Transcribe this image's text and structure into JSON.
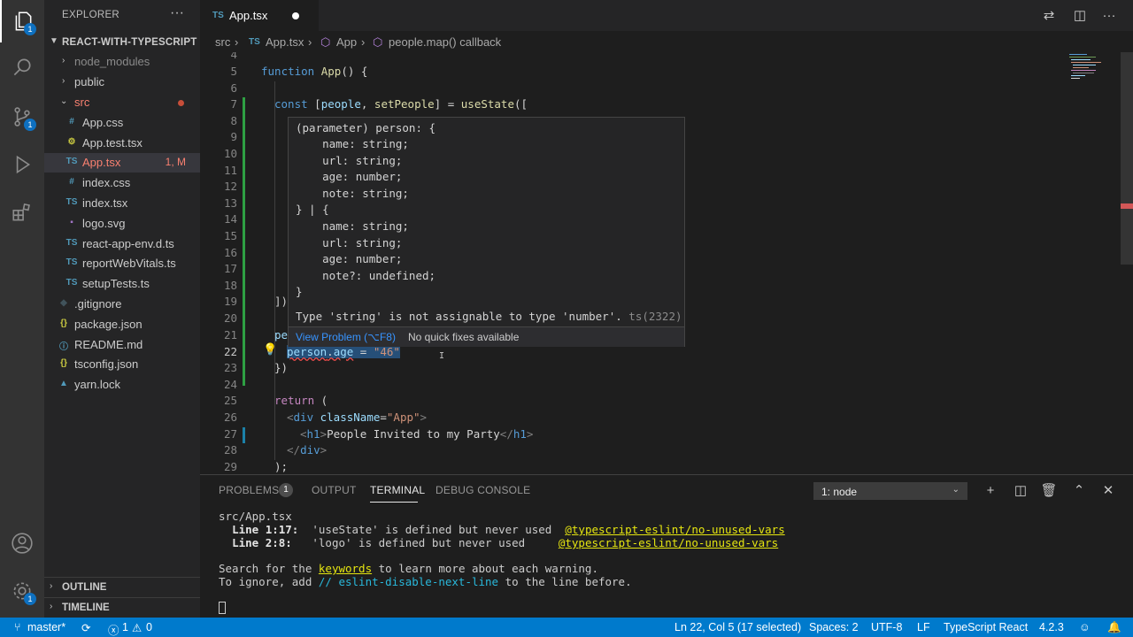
{
  "activity_bar": {
    "explorer_badge": "1",
    "scm_badge": "1",
    "manage_badge": "1"
  },
  "sidebar": {
    "title": "EXPLORER",
    "more": "···",
    "root_folder": "REACT-WITH-TYPESCRIPT",
    "items": [
      {
        "label": "node_modules",
        "kind": "folder"
      },
      {
        "label": "public",
        "kind": "folder"
      },
      {
        "label": "src",
        "kind": "folder-open"
      },
      {
        "label": "App.css",
        "icon": "#"
      },
      {
        "label": "App.test.tsx",
        "icon": "⚙"
      },
      {
        "label": "App.tsx",
        "icon": "TS",
        "status": "1, M"
      },
      {
        "label": "index.css",
        "icon": "#"
      },
      {
        "label": "index.tsx",
        "icon": "TS"
      },
      {
        "label": "logo.svg",
        "icon": "▪"
      },
      {
        "label": "react-app-env.d.ts",
        "icon": "TS"
      },
      {
        "label": "reportWebVitals.ts",
        "icon": "TS"
      },
      {
        "label": "setupTests.ts",
        "icon": "TS"
      },
      {
        "label": ".gitignore",
        "icon": "◆"
      },
      {
        "label": "package.json",
        "icon": "{}"
      },
      {
        "label": "README.md",
        "icon": "ⓘ"
      },
      {
        "label": "tsconfig.json",
        "icon": "{}"
      },
      {
        "label": "yarn.lock",
        "icon": "▲"
      }
    ],
    "outline": "OUTLINE",
    "timeline": "TIMELINE"
  },
  "tab": {
    "lang": "TS",
    "name": "App.tsx"
  },
  "breadcrumb": {
    "folder": "src",
    "file_lang": "TS",
    "file": "App.tsx",
    "symbol": "App",
    "callback": "people.map() callback"
  },
  "editor": {
    "line_numbers": [
      "4",
      "5",
      "6",
      "7",
      "8",
      "9",
      "10",
      "11",
      "12",
      "13",
      "14",
      "15",
      "16",
      "17",
      "18",
      "19",
      "20",
      "21",
      "22",
      "23",
      "24",
      "25",
      "26",
      "27",
      "28",
      "29"
    ],
    "lines": {
      "l5": {
        "kw": "function",
        "fn": "App",
        "rest": "() {"
      },
      "l7": {
        "kw": "const",
        "open": "[",
        "a": "people",
        "comma": ", ",
        "b": "setPeople",
        "close": "] = ",
        "fn": "useState",
        "tail": "(["
      },
      "l19": "])",
      "l21": "pe",
      "l22": {
        "obj": "person",
        "dot": ".",
        "prop": "age",
        "op": " = ",
        "str": "\"46\""
      },
      "l23": "})",
      "l25": {
        "kw": "return",
        "rest": " ("
      },
      "l26": {
        "lt": "<",
        "tag": "div",
        "attr": " className",
        "eq": "=",
        "val": "\"App\"",
        "gt": ">"
      },
      "l27": {
        "lt": "<",
        "tag": "h1",
        "gt": ">",
        "text": "People Invited to my Party",
        "close_lt": "</",
        "close_tag": "h1",
        "close_gt": ">"
      },
      "l28": {
        "lt": "</",
        "tag": "div",
        "gt": ">"
      },
      "l29": ");"
    }
  },
  "hover": {
    "lines": [
      "(parameter) person: {",
      "    name: string;",
      "    url: string;",
      "    age: number;",
      "    note: string;",
      "} | {",
      "    name: string;",
      "    url: string;",
      "    age: number;",
      "    note?: undefined;",
      "}"
    ],
    "error": "Type 'string' is not assignable to type 'number'.",
    "error_code": "ts(2322)",
    "view_problem": "View Problem (⌥F8)",
    "no_fixes": "No quick fixes available"
  },
  "panel": {
    "tabs": [
      "PROBLEMS",
      "OUTPUT",
      "TERMINAL",
      "DEBUG CONSOLE"
    ],
    "problems_count": "1",
    "terminal_select": "1: node",
    "terminal": {
      "file": "src/App.tsx",
      "w1_loc": "Line 1:17:",
      "w1_msg": "  'useState' is defined but never used",
      "w1_rule": "@typescript-eslint/no-unused-vars",
      "w2_loc": "Line 2:8:",
      "w2_msg": "   'logo' is defined but never used",
      "w2_rule": "@typescript-eslint/no-unused-vars",
      "s1_a": "Search for the ",
      "s1_kw": "keywords",
      "s1_b": " to learn more about each warning.",
      "s2_a": "To ignore, add ",
      "s2_c": "// eslint-disable-next-line",
      "s2_b": " to the line before."
    }
  },
  "statusbar": {
    "branch": "master*",
    "errors": "1",
    "warnings": "0",
    "position": "Ln 22, Col 5 (17 selected)",
    "spaces": "Spaces: 2",
    "encoding": "UTF-8",
    "eol": "LF",
    "language": "TypeScript React",
    "version": "4.2.3"
  },
  "colors": {
    "accent": "#007acc",
    "error": "#f14c4c",
    "modified": "#f88070"
  }
}
